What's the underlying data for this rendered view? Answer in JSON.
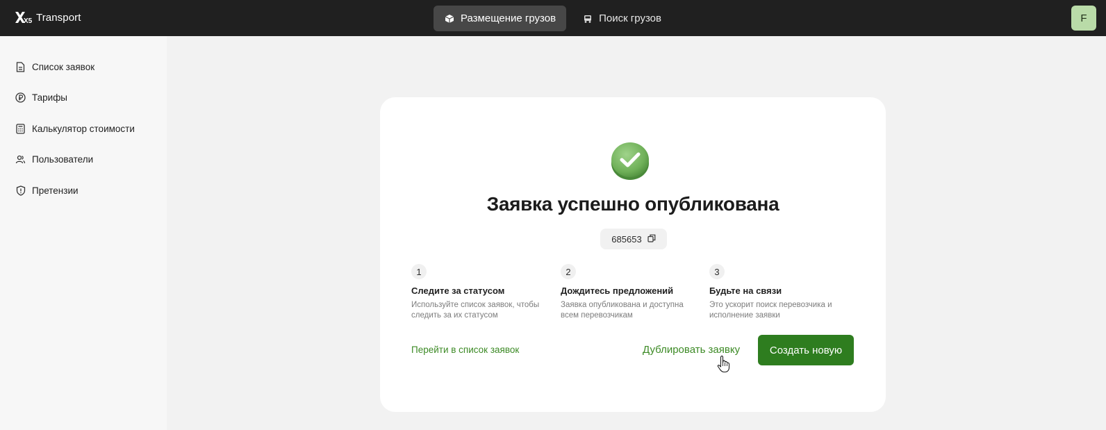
{
  "header": {
    "logo_text": "Transport",
    "logo_mark": "X5",
    "nav": [
      {
        "label": "Размещение грузов",
        "icon": "box-icon",
        "active": true
      },
      {
        "label": "Поиск грузов",
        "icon": "truck-icon",
        "active": false
      }
    ],
    "avatar_letter": "F"
  },
  "sidebar": {
    "items": [
      {
        "label": "Список заявок",
        "icon": "document-icon"
      },
      {
        "label": "Тарифы",
        "icon": "ruble-icon"
      },
      {
        "label": "Калькулятор стоимости",
        "icon": "calculator-icon"
      },
      {
        "label": "Пользователи",
        "icon": "users-icon"
      },
      {
        "label": "Претензии",
        "icon": "shield-icon"
      }
    ]
  },
  "card": {
    "title": "Заявка успешно опубликована",
    "order_number": "685653",
    "steps": [
      {
        "num": "1",
        "title": "Следите за статусом",
        "desc": "Используйте список заявок, чтобы следить за их статусом"
      },
      {
        "num": "2",
        "title": "Дождитесь предложений",
        "desc": "Заявка опубликована и доступна всем перевозчикам"
      },
      {
        "num": "3",
        "title": "Будьте на связи",
        "desc": "Это ускорит поиск перевозчика и исполнение заявки"
      }
    ],
    "link_list": "Перейти в список заявок",
    "link_duplicate": "Дублировать заявку",
    "create_button": "Создать новую"
  },
  "colors": {
    "topbar": "#202020",
    "accent_green": "#2e7d1f",
    "link_green": "#3c8a25",
    "avatar_bg": "#b9dba8"
  }
}
